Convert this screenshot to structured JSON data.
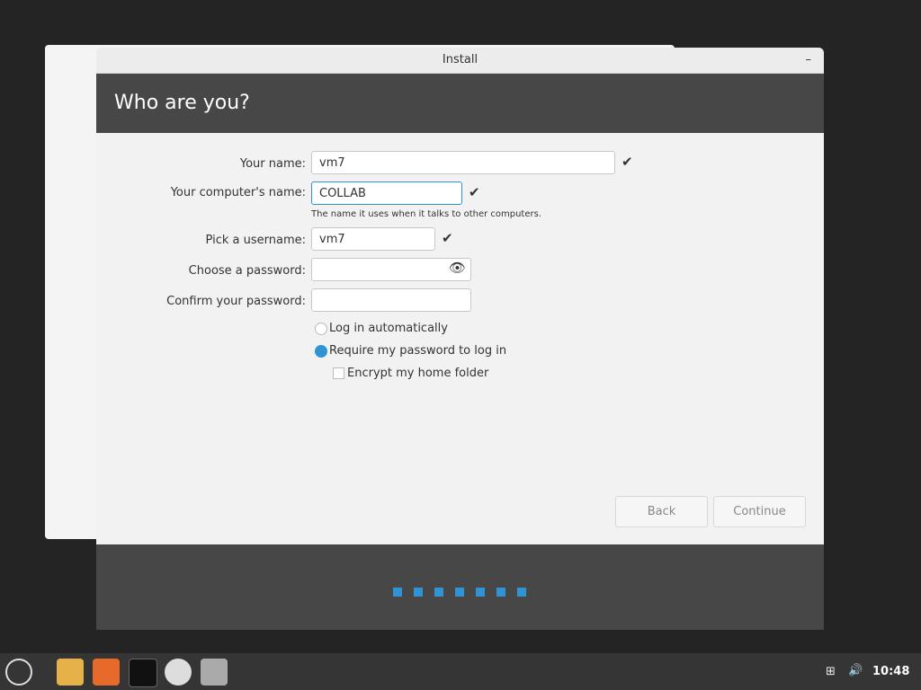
{
  "window": {
    "title": "Install",
    "heading": "Who are you?"
  },
  "form": {
    "name_label": "Your name:",
    "name_value": "vm7",
    "comp_label": "Your computer's name:",
    "comp_value": "COLLAB",
    "comp_hint": "The name it uses when it talks to other computers.",
    "user_label": "Pick a username:",
    "user_value": "vm7",
    "pw_label": "Choose a password:",
    "pw2_label": "Confirm your password:"
  },
  "options": {
    "auto": "Log in automatically",
    "require": "Require my password to log in",
    "encrypt": "Encrypt my home folder"
  },
  "buttons": {
    "back": "Back",
    "continue": "Continue"
  },
  "panel": {
    "clock": "10:48"
  },
  "colors": {
    "accent": "#2f93d4"
  }
}
